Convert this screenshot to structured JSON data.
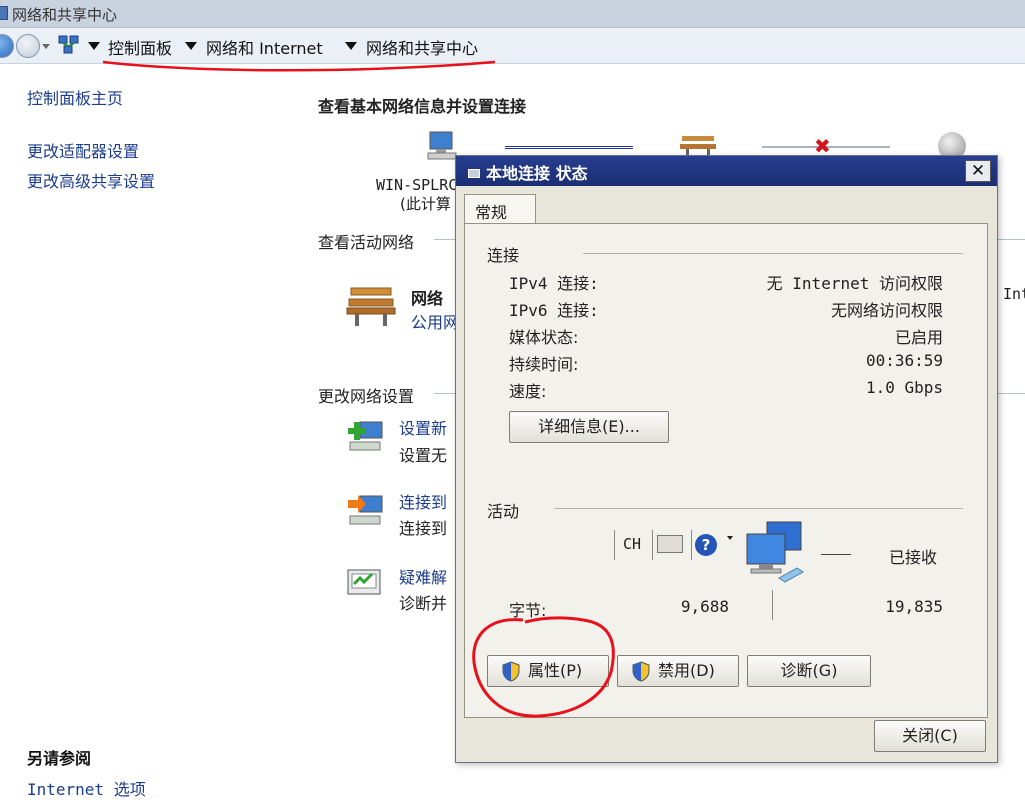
{
  "window": {
    "title": "网络和共享中心"
  },
  "breadcrumb": [
    "控制面板",
    "网络和 Internet",
    "网络和共享中心"
  ],
  "sidebar": {
    "home": "控制面板主页",
    "links": [
      "更改适配器设置",
      "更改高级共享设置"
    ],
    "see_also_title": "另请参阅",
    "see_also_links": [
      "Internet 选项"
    ]
  },
  "main": {
    "title": "查看基本网络信息并设置连接",
    "computer_name": "WIN-SPLRC",
    "computer_sub": "(此计算",
    "active_networks_title": "查看活动网络",
    "network_name": "网络",
    "network_type": "公用网",
    "right_cut_text": "Int",
    "change_settings_title": "更改网络设置",
    "tasks": [
      {
        "link": "设置新",
        "desc": "设置无"
      },
      {
        "link": "连接到",
        "desc": "连接到"
      },
      {
        "link": "疑难解",
        "desc": "诊断并"
      }
    ]
  },
  "dialog": {
    "title": "本地连接 状态",
    "close_glyph": "✕",
    "tab": "常规",
    "connection_group": "连接",
    "rows": [
      {
        "label": "IPv4 连接:",
        "value": "无 Internet 访问权限"
      },
      {
        "label": "IPv6 连接:",
        "value": "无网络访问权限"
      },
      {
        "label": "媒体状态:",
        "value": "已启用"
      },
      {
        "label": "持续时间:",
        "value": "00:36:59"
      },
      {
        "label": "速度:",
        "value": "1.0 Gbps"
      }
    ],
    "details_button": "详细信息(E)...",
    "activity_group": "活动",
    "language_indicator": "CH",
    "help_glyph": "?",
    "received_label": "已接收",
    "bytes_label": "字节:",
    "bytes_sent": "9,688",
    "bytes_received": "19,835",
    "buttons": {
      "properties": "属性(P)",
      "disable": "禁用(D)",
      "diagnose": "诊断(G)"
    },
    "close_button": "关闭(C)"
  },
  "colors": {
    "annotation_red": "#e8101a",
    "link_blue": "#1c3d8e",
    "dialog_title": "#273e8f"
  }
}
